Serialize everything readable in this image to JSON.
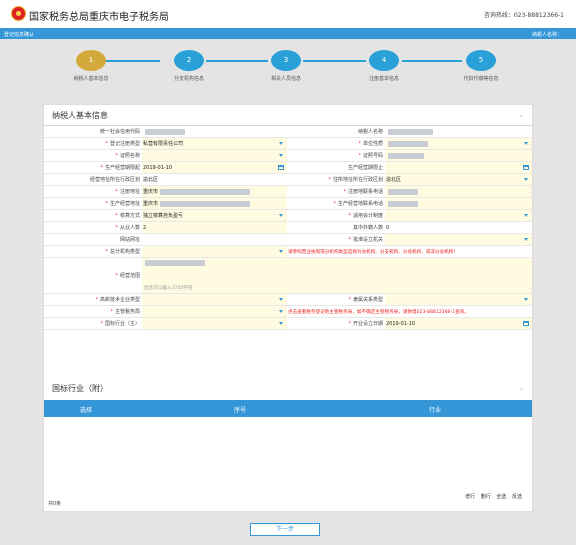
{
  "header": {
    "title": "国家税务总局重庆市电子税务局",
    "hotline": "咨询热线：023-88812366-1"
  },
  "navbar": {
    "left": "登记信息确认",
    "right": "纳税人名称："
  },
  "steps": [
    {
      "num": "1",
      "label": "纳税人基本信息"
    },
    {
      "num": "2",
      "label": "分支机构信息"
    },
    {
      "num": "3",
      "label": "相关人员信息"
    },
    {
      "num": "4",
      "label": "注册基本信息"
    },
    {
      "num": "5",
      "label": "代扣代缴等信息"
    }
  ],
  "section1": {
    "title": "纳税人基本信息"
  },
  "form": {
    "uscc_label": "统一社会信用代码",
    "uscc_value": "",
    "name_label": "纳税人名称",
    "name_value": "",
    "reg_type_label": "登记注册类型",
    "reg_type_value": "私营有限责任公司",
    "unit_nature_label": "单位性质",
    "unit_nature_value": "",
    "id_type_label": "证照名称",
    "id_type_value": "",
    "id_no_label": "证照号码",
    "id_no_value": "",
    "start_date_label": "生产经营期限起",
    "start_date_value": "2019-01-10",
    "end_date_label": "生产经营期限止",
    "end_date_value": "",
    "district_label": "经营地址所在行政区划",
    "district_value": "渝北区",
    "res_district_label": "住所地址所在行政区划",
    "res_district_value": "渝北区",
    "reg_addr_label": "注册地址",
    "reg_addr_value": "重庆市",
    "reg_phone_label": "注册地联系电话",
    "reg_phone_value": "",
    "biz_addr_label": "生产经营地址",
    "biz_addr_value": "重庆市",
    "biz_phone_label": "生产经营地联系电话",
    "biz_phone_value": "",
    "accounting_label": "核算方式",
    "accounting_value": "独立核算自负盈亏",
    "acc_system_label": "适用会计制度",
    "acc_system_value": "",
    "employees_label": "从业人数",
    "employees_value": "2",
    "foreign_label": "其中外籍人数",
    "foreign_value": "0",
    "website_label": "网站网址",
    "website_value": "",
    "approval_org_label": "批准设立机关",
    "approval_org_value": "",
    "branch_type_label": "总分机构类型",
    "branch_type_value": "",
    "branch_note": "请参照营业执照或分机构类型选择为总机构、分支机构、分总机构，或非分总机构！",
    "scope_label": "经营范围",
    "scope_value": "",
    "scope_hint": "您还可以输入3750字符",
    "tech_type_label": "高新技术企业类型",
    "tech_type_value": "",
    "region_type_label": "隶属关系类型",
    "region_type_value": "",
    "tax_office_label": "主管税务局",
    "tax_office_value": "",
    "tax_note": "点击查看税务登记地主管税务局，如不确定主管税务局，请致电023-88812366-1查询。",
    "industry_label": "国标行业（主）",
    "industry_value": "",
    "open_date_label": "开业设立日期",
    "open_date_value": "2019-01-10"
  },
  "section2": {
    "title": "国标行业（附）"
  },
  "table": {
    "columns": [
      "选择",
      "序号",
      "行业"
    ],
    "links": [
      "增行",
      "删行",
      "全选",
      "反选"
    ],
    "count": "共0条"
  },
  "next_button": "下一步"
}
